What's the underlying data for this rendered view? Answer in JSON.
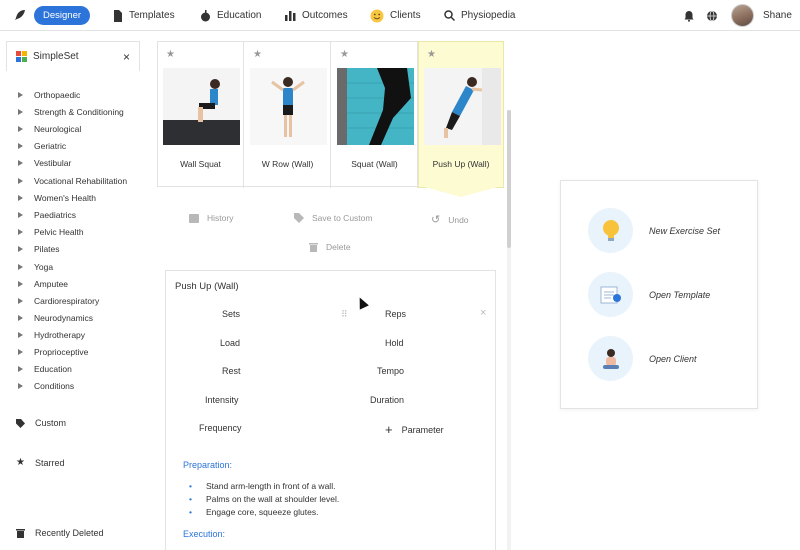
{
  "nav": {
    "designer_label": "Designer",
    "templates_label": "Templates",
    "education_label": "Education",
    "outcomes_label": "Outcomes",
    "clients_label": "Clients",
    "physiopedia_label": "Physiopedia",
    "user_name": "Shane"
  },
  "sidebar": {
    "title": "SimpleSet",
    "close_glyph": "×",
    "categories": [
      "Orthopaedic",
      "Strength & Conditioning",
      "Neurological",
      "Geriatric",
      "Vestibular",
      "Vocational Rehabilitation",
      "Women's Health",
      "Paediatrics",
      "Pelvic Health",
      "Pilates",
      "Yoga",
      "Amputee",
      "Cardiorespiratory",
      "Neurodynamics",
      "Hydrotherapy",
      "Proprioceptive",
      "Education",
      "Conditions"
    ],
    "custom_label": "Custom",
    "starred_label": "Starred",
    "deleted_label": "Recently Deleted"
  },
  "exercises": [
    {
      "name": "Wall Squat",
      "selected": false
    },
    {
      "name": "W Row (Wall)",
      "selected": false
    },
    {
      "name": "Squat (Wall)",
      "selected": false
    },
    {
      "name": "Push Up (Wall)",
      "selected": true
    }
  ],
  "toolbar": {
    "history_label": "History",
    "save_custom_label": "Save to Custom",
    "undo_label": "Undo",
    "delete_label": "Delete"
  },
  "detail": {
    "title": "Push Up (Wall)",
    "params_left": [
      "Sets",
      "Load",
      "Rest",
      "Intensity",
      "Frequency"
    ],
    "params_right": [
      "Reps",
      "Hold",
      "Tempo",
      "Duration"
    ],
    "add_parameter_label": "Parameter",
    "close_glyph": "×",
    "preparation_heading": "Preparation:",
    "preparation_steps": [
      "Stand arm-length in front of a wall.",
      "Palms on the wall at shoulder level.",
      "Engage core, squeeze glutes."
    ],
    "execution_heading": "Execution:"
  },
  "quick_actions": {
    "new_set_label": "New Exercise Set",
    "open_template_label": "Open Template",
    "open_client_label": "Open Client"
  },
  "colors": {
    "accent": "#2d74da",
    "selected_card": "#fdfbd2"
  }
}
